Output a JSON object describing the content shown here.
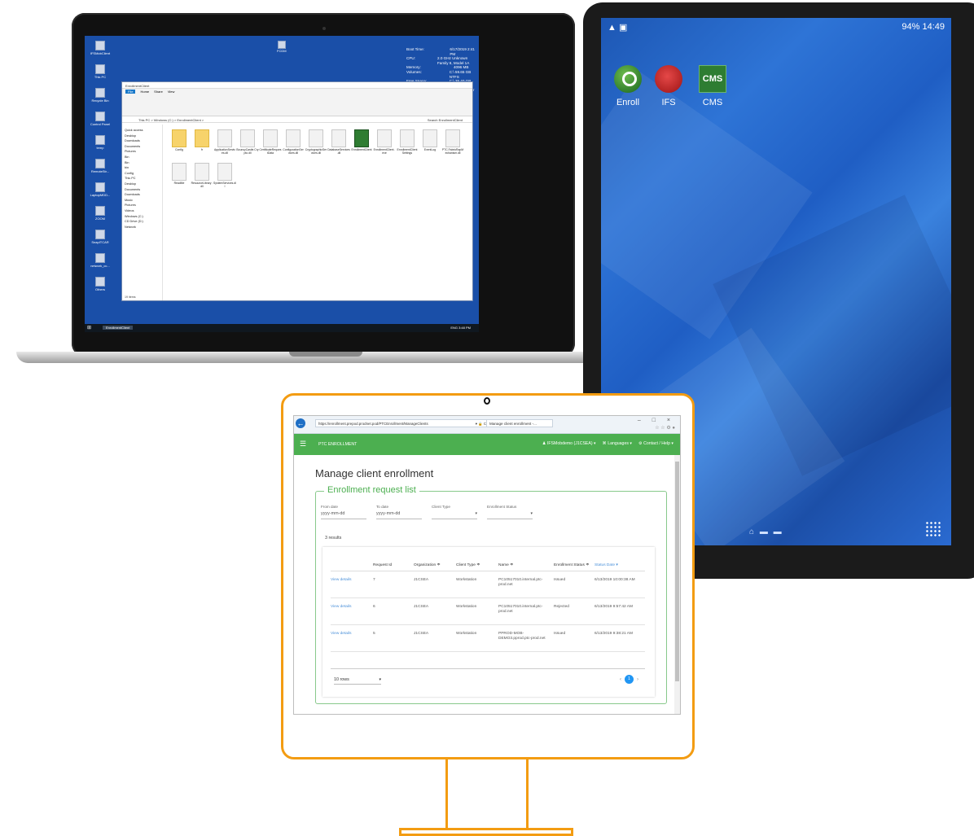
{
  "laptop": {
    "desktop_icons": [
      {
        "label": "IFSMobClient"
      },
      {
        "label": "This PC"
      },
      {
        "label": "Recycle Bin"
      },
      {
        "label": "Control Panel"
      },
      {
        "label": "temp"
      },
      {
        "label": "RemoteStr..."
      },
      {
        "label": "LaptopMDD..."
      },
      {
        "label": "ZOOM"
      },
      {
        "label": "SnapITCAR"
      },
      {
        "label": "network_cc..."
      },
      {
        "label": "Others"
      }
    ],
    "center_icon_label": "FCDM",
    "sysinfo": [
      {
        "k": "Boot Time:",
        "v": "6/17/2019 2:41 PM"
      },
      {
        "k": "CPU:",
        "v": "2.0 GHz Unknown Family 6, Model 1A"
      },
      {
        "k": "Memory:",
        "v": "4096 MB"
      },
      {
        "k": "Volumes:",
        "v": "C:\\ 59.65 GB NTFS"
      },
      {
        "k": "Free Space:",
        "v": "C:\\ 35.40 GB NTFS"
      },
      {
        "k": "OS Version:",
        "v": "Windows Server 2016"
      },
      {
        "k": "Service Pack:",
        "v": "Datacenter"
      }
    ],
    "explorer": {
      "title": "EnrollmentClient",
      "tabs": [
        "File",
        "Home",
        "Share",
        "View"
      ],
      "address": "This PC > Windows (C:) > EnrollmentClient >",
      "search": "Search EnrollmentClient",
      "nav": [
        "Quick access",
        "Desktop",
        "Downloads",
        "Documents",
        "Pictures",
        "Bin",
        "Bin",
        "bin",
        "Config",
        "This PC",
        "Desktop",
        "Documents",
        "Downloads",
        "Music",
        "Pictures",
        "Videos",
        "Windows (C:)",
        "CD Drive (D:)",
        "Network"
      ],
      "files": [
        {
          "name": "Config",
          "kind": "folder"
        },
        {
          "name": "fr",
          "kind": "folder"
        },
        {
          "name": "ApplicationServic es.dll",
          "kind": "file"
        },
        {
          "name": "BouncyCastle.Cry pto.dll",
          "kind": "file"
        },
        {
          "name": "CertificateReques tData",
          "kind": "file"
        },
        {
          "name": "ConfigurationSer vices.dll",
          "kind": "file"
        },
        {
          "name": "CryptographicSer vices.dll",
          "kind": "file"
        },
        {
          "name": "DatabaseServices .dll",
          "kind": "file"
        },
        {
          "name": "EnrollmentClient",
          "kind": "key"
        },
        {
          "name": "EnrollmentClient .exe",
          "kind": "file"
        },
        {
          "name": "EnrollmentClient Settings",
          "kind": "file"
        },
        {
          "name": "EventLog",
          "kind": "file"
        },
        {
          "name": "PTC.FabricRapM echanism.dll",
          "kind": "file"
        },
        {
          "name": "ReadMe",
          "kind": "file"
        },
        {
          "name": "ResourceLibrary .dll",
          "kind": "file"
        },
        {
          "name": "SystemServices.dl l",
          "kind": "file"
        }
      ],
      "items_count": "19 items"
    },
    "taskbar": {
      "app": "EnrollmentClient",
      "clock": "ENG 3:48 PM"
    }
  },
  "tablet": {
    "status_left": "▲ ▣",
    "status_right": "94% 14:49",
    "apps": [
      {
        "label": "Enroll",
        "icon": "enroll-key-icon"
      },
      {
        "label": "IFS",
        "icon": "ifs-icon"
      },
      {
        "label": "CMS",
        "icon": "cms-icon",
        "text": "CMS"
      }
    ],
    "nav_glyph": "⌂ ▬ ▬",
    "apps_grid": "apps-grid-icon"
  },
  "browser": {
    "url": "https://enrollment.prepod.prodnet.pod/PTCEnrollment/ManageClients",
    "url_controls": "▾ 🔒 C",
    "tab_title": "Manage client enrollment -...",
    "window_controls": "–  □  ×",
    "bookmark_glyphs": "☆ ☆ ⚙ ●"
  },
  "app": {
    "brand": "PTC ENROLLMENT",
    "user": "IFSMobdemo (J1CSEA) ▾",
    "languages": "Languages ▾",
    "contact": "Contact / Help ▾",
    "title": "Manage client enrollment",
    "legend": "Enrollment request list",
    "filters": {
      "from_label": "From date",
      "from_placeholder": "yyyy-mm-dd",
      "to_label": "To date",
      "to_placeholder": "yyyy-mm-dd",
      "client_type_label": "Client Type",
      "status_label": "Enrollment Status"
    },
    "results": "3 results",
    "columns": [
      "",
      "Request Id",
      "Organization ≑",
      "Client Type ≑",
      "Name ≑",
      "Enrollment Status ≑",
      "Status Date ▾"
    ],
    "rows": [
      {
        "action": "View details",
        "id": "7",
        "org": "J1CSEA",
        "type": "Workstation",
        "name": "PC10517010.internal.ptc-prod.net",
        "status": "Issued",
        "date": "6/13/2019 10:00:38 AM"
      },
      {
        "action": "View details",
        "id": "6",
        "org": "J1CSEA",
        "type": "Workstation",
        "name": "PC10517010.internal.ptc-prod.net",
        "status": "Rejected",
        "date": "6/13/2019 9:57:42 AM"
      },
      {
        "action": "View details",
        "id": "5",
        "org": "J1CSEA",
        "type": "Workstation",
        "name": "PPROD-MOB-DEMO3.pprod.ptc-prod.net",
        "status": "Issued",
        "date": "6/13/2019 9:38:21 AM"
      }
    ],
    "rows_per_page": "10 rows",
    "pager": {
      "prev": "‹",
      "current": "1",
      "next": "›"
    }
  },
  "colors": {
    "accent_green": "#4caf50",
    "monitor_outline": "#f39c12",
    "link_blue": "#4a90d9"
  }
}
